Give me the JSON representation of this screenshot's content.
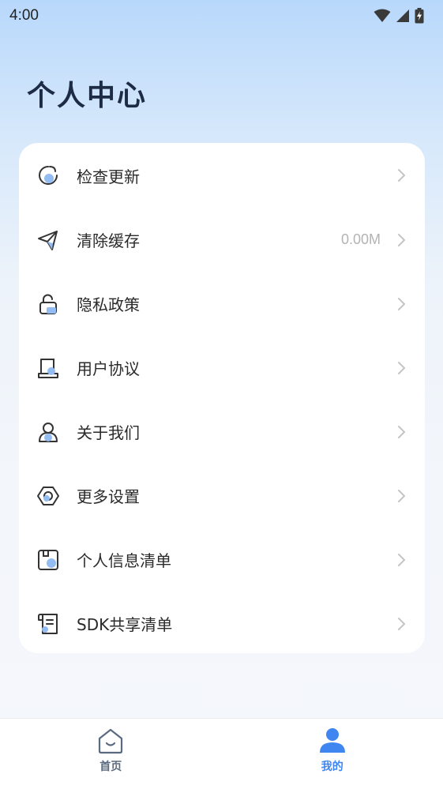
{
  "status_bar": {
    "time": "4:00",
    "icons": [
      "wifi-icon",
      "signal-icon",
      "battery-charging-icon"
    ]
  },
  "page": {
    "title": "个人中心"
  },
  "menu": {
    "items": [
      {
        "label": "检查更新",
        "icon": "check-update-icon"
      },
      {
        "label": "清除缓存",
        "icon": "paper-plane-icon",
        "value": "0.00M"
      },
      {
        "label": "隐私政策",
        "icon": "lock-icon"
      },
      {
        "label": "用户协议",
        "icon": "agreement-icon"
      },
      {
        "label": "关于我们",
        "icon": "person-icon"
      },
      {
        "label": "更多设置",
        "icon": "settings-hex-icon"
      },
      {
        "label": "个人信息清单",
        "icon": "personal-info-list-icon"
      },
      {
        "label": "SDK共享清单",
        "icon": "sdk-list-icon"
      }
    ]
  },
  "tab_bar": {
    "tabs": [
      {
        "label": "首页",
        "icon": "home-icon",
        "active": false
      },
      {
        "label": "我的",
        "icon": "profile-icon",
        "active": true
      }
    ]
  },
  "colors": {
    "accent": "#3f86f0",
    "icon_fill": "#93bcf3",
    "icon_stroke": "#333333",
    "title": "#1d2b44"
  }
}
